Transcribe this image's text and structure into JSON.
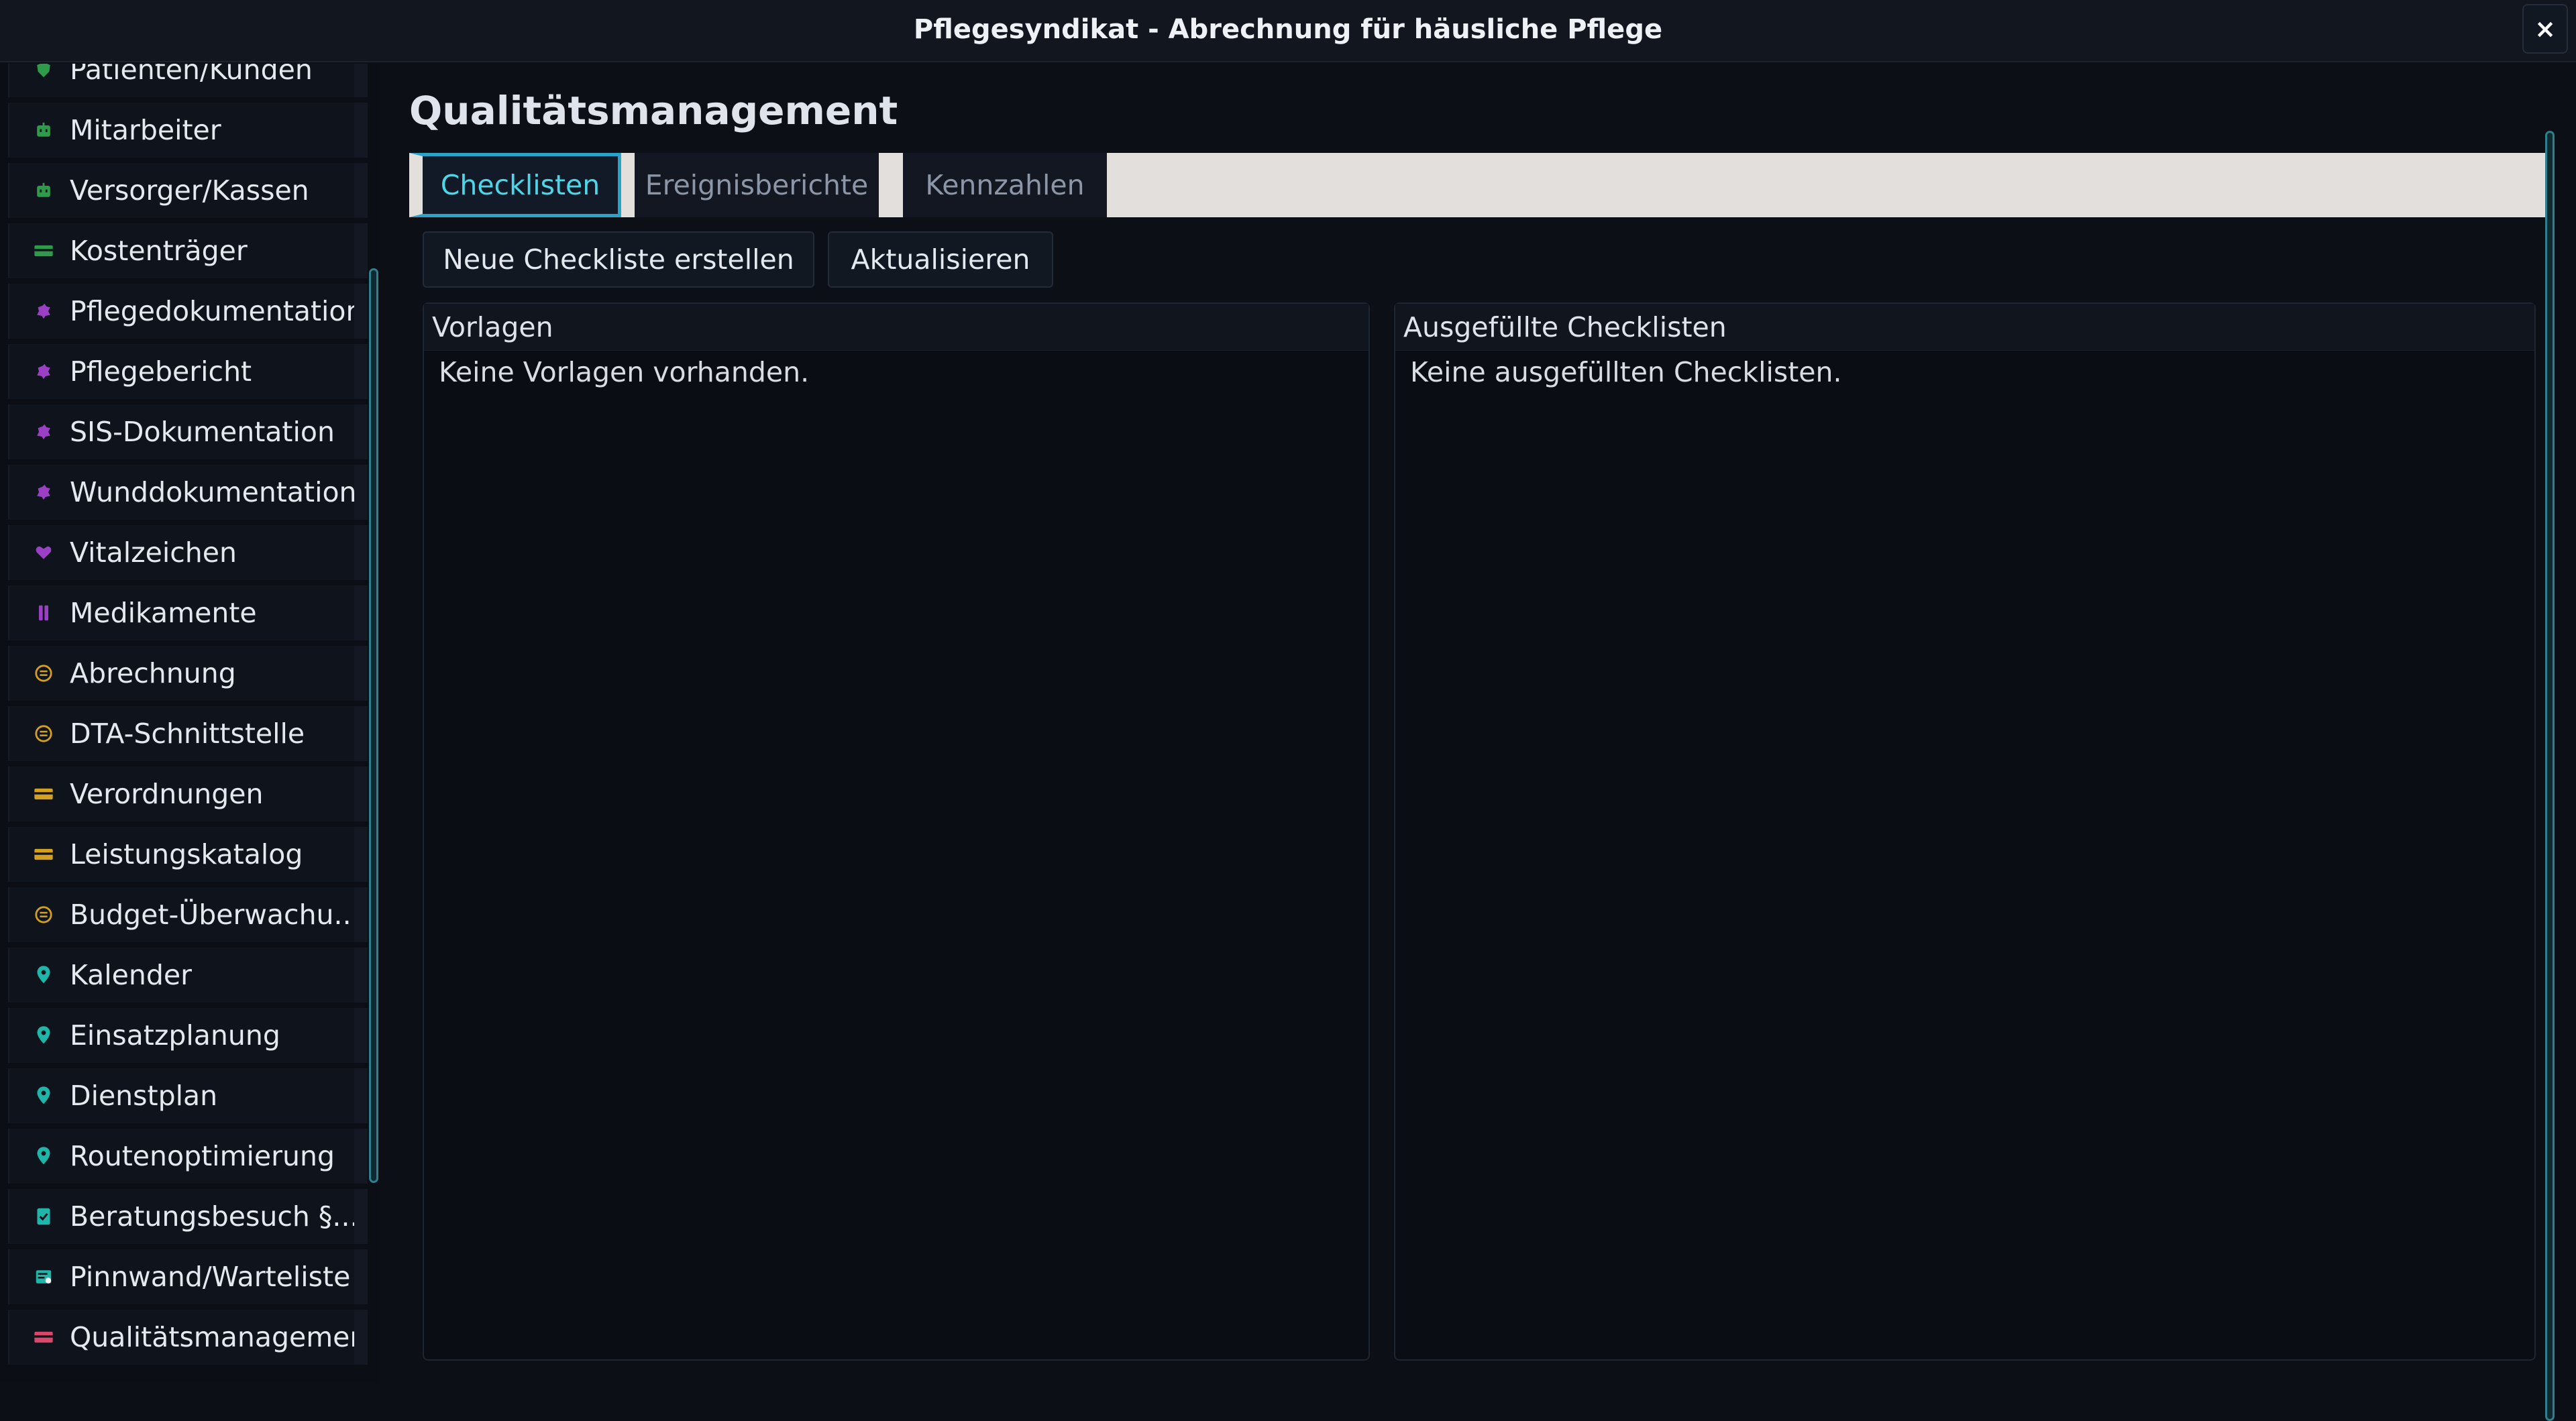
{
  "window": {
    "title": "Pflegesyndikat - Abrechnung für häusliche Pflege",
    "close_label": "×"
  },
  "sidebar": {
    "items": [
      {
        "label": "Patienten/Kunden",
        "icon": "shield-icon",
        "color": "#2e9b4a"
      },
      {
        "label": "Mitarbeiter",
        "icon": "robot-icon",
        "color": "#2e9b4a"
      },
      {
        "label": "Versorger/Kassen",
        "icon": "robot-icon",
        "color": "#2e9b4a"
      },
      {
        "label": "Kostenträger",
        "icon": "card-icon",
        "color": "#2e9b4a"
      },
      {
        "label": "Pflegedokumentation",
        "icon": "puzzle-icon",
        "color": "#9b3fc4"
      },
      {
        "label": "Pflegebericht",
        "icon": "puzzle-icon",
        "color": "#9b3fc4"
      },
      {
        "label": "SIS-Dokumentation",
        "icon": "puzzle-icon",
        "color": "#9b3fc4"
      },
      {
        "label": "Wunddokumentation",
        "icon": "puzzle-icon",
        "color": "#9b3fc4"
      },
      {
        "label": "Vitalzeichen",
        "icon": "heart-icon",
        "color": "#9b3fc4"
      },
      {
        "label": "Medikamente",
        "icon": "pause-icon",
        "color": "#9b3fc4"
      },
      {
        "label": "Abrechnung",
        "icon": "coin-icon",
        "color": "#d4a020"
      },
      {
        "label": "DTA-Schnittstelle",
        "icon": "coin-icon",
        "color": "#d4a020"
      },
      {
        "label": "Verordnungen",
        "icon": "card-icon",
        "color": "#d4a020"
      },
      {
        "label": "Leistungskatalog",
        "icon": "card-icon",
        "color": "#d4a020"
      },
      {
        "label": "Budget-Überwachu...",
        "icon": "coin-icon",
        "color": "#d4a020"
      },
      {
        "label": "Kalender",
        "icon": "pin-icon",
        "color": "#1fb5a8"
      },
      {
        "label": "Einsatzplanung",
        "icon": "pin-icon",
        "color": "#1fb5a8"
      },
      {
        "label": "Dienstplan",
        "icon": "pin-icon",
        "color": "#1fb5a8"
      },
      {
        "label": "Routenoptimierung",
        "icon": "pin-icon",
        "color": "#1fb5a8"
      },
      {
        "label": "Beratungsbesuch §...",
        "icon": "clipboard-check-icon",
        "color": "#1fb5a8"
      },
      {
        "label": "Pinnwand/Warteliste",
        "icon": "note-icon",
        "color": "#1fb5a8"
      },
      {
        "label": "Qualitätsmanagement",
        "icon": "card-icon",
        "color": "#d9486a"
      }
    ]
  },
  "main": {
    "title": "Qualitätsmanagement",
    "tabs": [
      {
        "label": "Checklisten",
        "active": true
      },
      {
        "label": "Ereignisberichte",
        "active": false
      },
      {
        "label": "Kennzahlen",
        "active": false
      }
    ],
    "toolbar": {
      "new_label": "Neue Checkliste erstellen",
      "refresh_label": "Aktualisieren"
    },
    "templates_panel": {
      "header": "Vorlagen",
      "empty_text": "Keine Vorlagen vorhanden."
    },
    "filled_panel": {
      "header": "Ausgefüllte Checklisten",
      "empty_text": "Keine ausgefüllten Checklisten."
    }
  }
}
